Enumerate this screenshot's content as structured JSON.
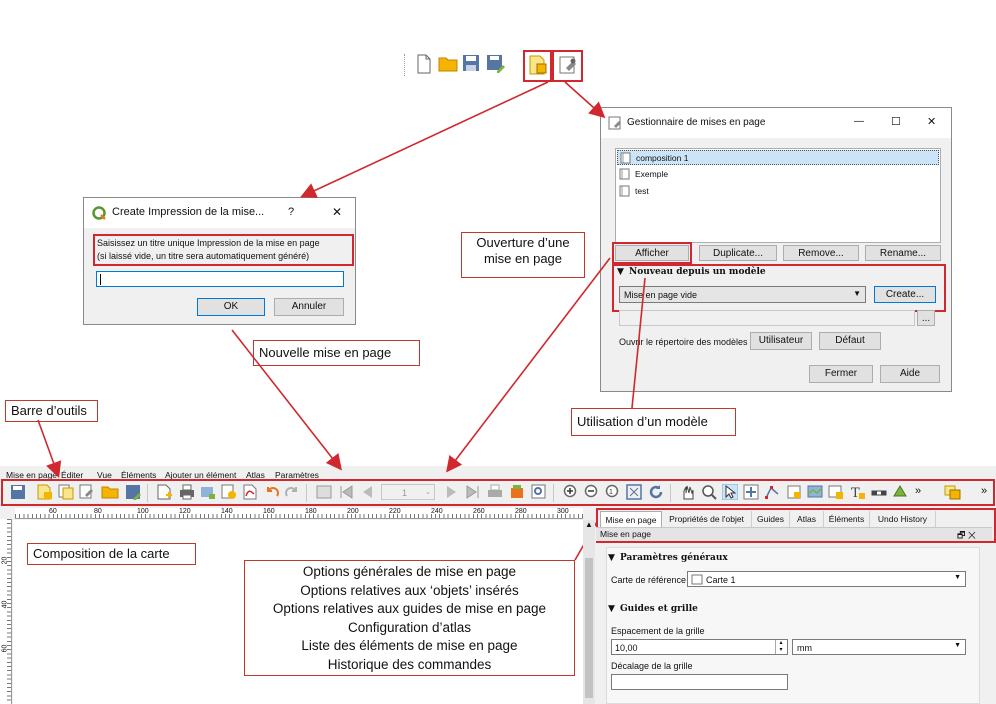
{
  "top_toolbar": {
    "icons": [
      "new-layout-icon",
      "open-folder-icon",
      "save-icon",
      "save-as-icon",
      "new-print-layout-icon",
      "layout-manager-icon"
    ]
  },
  "create_dialog": {
    "title": "Create Impression de la mise...",
    "help": "?",
    "close": "✕",
    "line1": "Saisissez un titre unique Impression de la mise en page",
    "line2": "(si laissé vide, un titre sera automatiquement généré)",
    "input_value": "",
    "ok": "OK",
    "cancel": "Annuler"
  },
  "manager": {
    "title": "Gestionnaire de mises en page",
    "minimize": "—",
    "maximize": "☐",
    "close": "✕",
    "layouts": [
      "composition 1",
      "Exemple",
      "test"
    ],
    "show": "Afficher",
    "duplicate": "Duplicate...",
    "remove": "Remove...",
    "rename": "Rename...",
    "template_section": "Nouveau depuis un modèle",
    "template_value": "Mise en page vide",
    "create": "Create...",
    "templates_dir_label": "Ouvrir le répertoire des modèles",
    "user_btn": "Utilisateur",
    "default_btn": "Défaut",
    "close_btn": "Fermer",
    "help_btn": "Aide",
    "browse_btn": "..."
  },
  "annotations": {
    "open_layout": [
      "Ouverture d’une",
      "mise en page"
    ],
    "new_layout": "Nouvelle mise en page",
    "use_template": "Utilisation d’un modèle",
    "toolbar": "Barre d’outils",
    "map_composition": "Composition de la carte",
    "panel_list": [
      "Options générales de mise en page",
      "Options relatives aux ‘objets’ insérés",
      "Options relatives aux guides de mise en page",
      "Configuration d’atlas",
      "Liste des éléments de mise en page",
      "Historique des commandes"
    ]
  },
  "layout_window": {
    "menus": [
      "Mise en page",
      "Éditer",
      "Vue",
      "Éléments",
      "Ajouter un élément",
      "Atlas",
      "Paramètres"
    ],
    "page_number": "1",
    "ruler_ticks": [
      "60",
      "80",
      "100",
      "120",
      "140",
      "160",
      "180",
      "200",
      "220",
      "240",
      "260",
      "280",
      "300"
    ],
    "vruler_ticks": [
      "20",
      "40",
      "60"
    ],
    "tabs": [
      "Mise en page",
      "Propriétés de l'objet",
      "Guides",
      "Atlas",
      "Éléments",
      "Undo History"
    ],
    "panel_title": "Mise en page",
    "panel_buttons": "🗗 ✕",
    "general_section": "Paramètres généraux",
    "reference_label": "Carte de référence",
    "reference_value": "Carte 1",
    "grid_section": "Guides et grille",
    "grid_spacing_label": "Espacement de la grille",
    "grid_spacing_value": "10,00",
    "unit_value": "mm",
    "grid_offset_label": "Décalage de la grille",
    "overflow": "»"
  },
  "colors": {
    "accent_red": "#d0282e",
    "selection_blue": "#cce4f7",
    "window_bg": "#f0f0f0"
  }
}
